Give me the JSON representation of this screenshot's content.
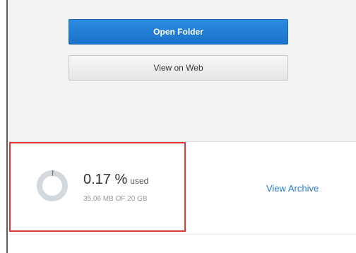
{
  "actions": {
    "open_folder_label": "Open Folder",
    "view_on_web_label": "View on Web"
  },
  "storage": {
    "percent_value": "0.17 %",
    "percent_suffix": "used",
    "usage_text": "35.06 MB OF 20 GB",
    "used_fraction": 0.0017,
    "gauge_icon": "storage-usage-donut-icon",
    "view_archive_label": "View Archive"
  },
  "colors": {
    "primary_button": "#1a72c9",
    "link": "#2b7bd0",
    "highlight_border": "#e03a3a",
    "gauge_track": "#d3d8dd",
    "gauge_fill": "#6a6f75"
  }
}
